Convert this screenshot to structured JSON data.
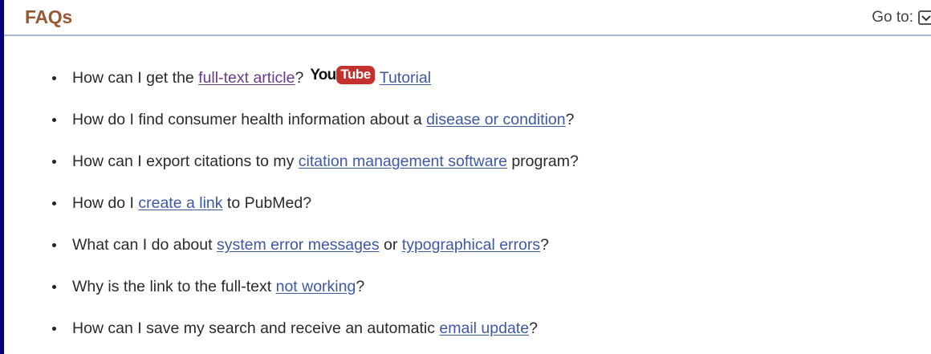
{
  "header": {
    "title": "FAQs",
    "goto_label": "Go to:",
    "goto_icon": "dropdown-check-icon"
  },
  "youtube": {
    "you": "You",
    "tube": "Tube",
    "tube_color": "#c4302b"
  },
  "colors": {
    "title": "#985735",
    "link": "#3d59a6",
    "visited_link": "#6a3a8c",
    "text": "#2a2a2a",
    "page_border": "#00007a"
  },
  "faqs": [
    {
      "before": "How can I get the ",
      "link": "full-text article",
      "after": "?",
      "extra_link": "Tutorial"
    },
    {
      "before": "How do I find consumer health information about a ",
      "link": "disease or condition",
      "after": "?"
    },
    {
      "before": "How can I export citations to my ",
      "link": "citation management software",
      "after": " program?"
    },
    {
      "before": "How do I ",
      "link": "create a link",
      "after": " to PubMed?"
    },
    {
      "before": "What can I do about ",
      "link": "system error messages",
      "middle": " or ",
      "link2": "typographical errors",
      "after": "?"
    },
    {
      "before": "Why is the link to the full-text ",
      "link": "not working",
      "after": "?"
    },
    {
      "before": "How can I save my search and receive an automatic ",
      "link": "email update",
      "after": "?"
    }
  ]
}
